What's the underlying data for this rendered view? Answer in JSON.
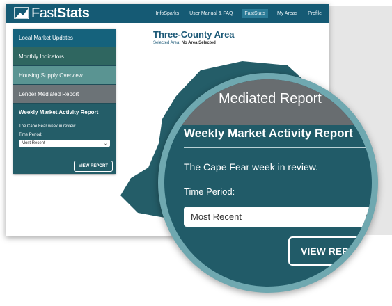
{
  "logo": {
    "text_light": "Fast",
    "text_bold": "Stats"
  },
  "nav": {
    "items": [
      "InfoSparks",
      "User Manual & FAQ",
      "FastStats",
      "My Areas",
      "Profile"
    ],
    "active_index": 2
  },
  "sidebar": {
    "items": [
      {
        "label": "Local Market Updates"
      },
      {
        "label": "Monthly Indicators"
      },
      {
        "label": "Housing Supply Overview"
      },
      {
        "label": "Lender Mediated Report"
      }
    ],
    "weekly": {
      "title": "Weekly Market Activity Report",
      "subtitle": "The Cape Fear week in review.",
      "time_label": "Time Period:",
      "select_value": "Most Recent",
      "button_label": "VIEW REPORT"
    }
  },
  "main": {
    "title": "Three-County Area",
    "selected_prefix": "Selected Area:",
    "selected_value": "No Area Selected"
  },
  "magnifier": {
    "partial_label": "Mediated Report",
    "title": "Weekly Market Activity Report",
    "subtitle": "The Cape Fear week in review.",
    "time_label": "Time Period:",
    "select_value": "Most Recent",
    "button_label": "VIEW REPORT"
  },
  "colors": {
    "header": "#155a74",
    "panel": "#245d68",
    "accent": "#6fa8b0"
  },
  "icons": {
    "logo": "bar-chart-icon",
    "dropdown": "chevron-down-icon"
  }
}
